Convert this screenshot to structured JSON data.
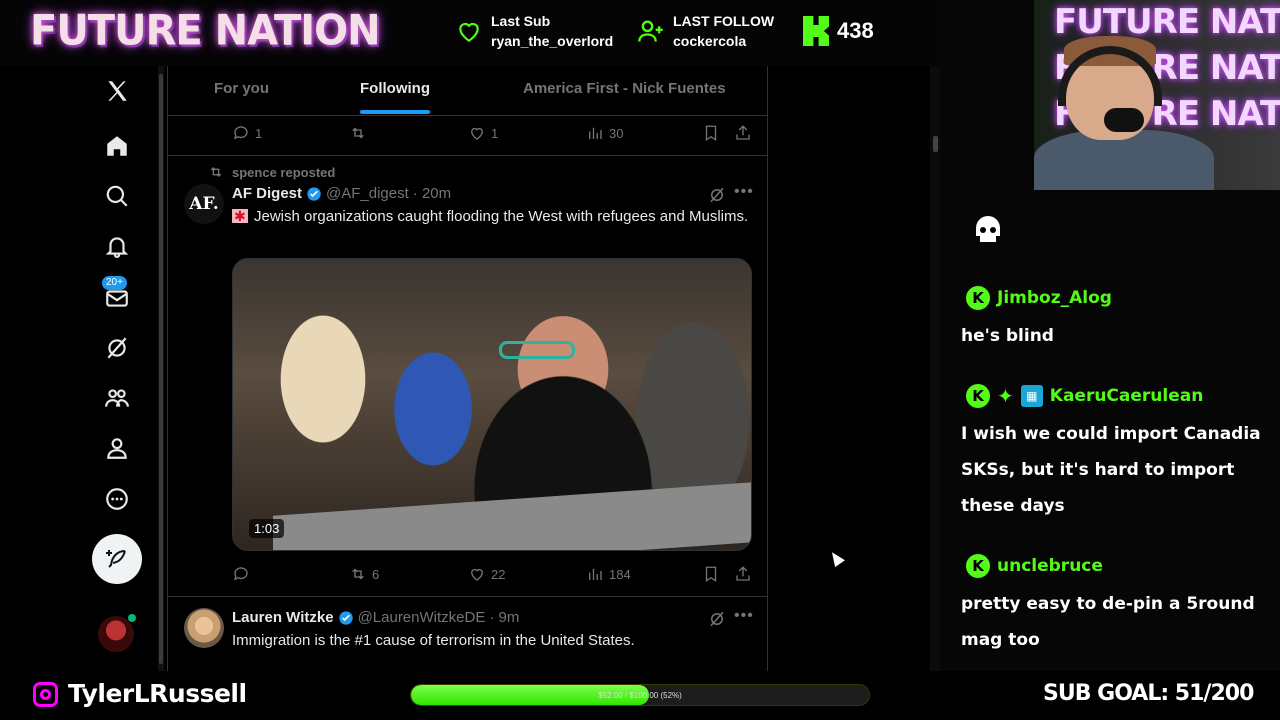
{
  "stream": {
    "brand": "FUTURE NATION",
    "last_sub_label": "Last Sub",
    "last_sub_user": "ryan_the_overlord",
    "last_follow_label": "LAST FOLLOW",
    "last_follow_user": "cockercola",
    "kick_count": "438",
    "accent": "#53fc18"
  },
  "twitter": {
    "tabs": [
      {
        "label": "For you"
      },
      {
        "label": "Following"
      },
      {
        "label": "America First - Nick Fuentes"
      }
    ],
    "active_tab": "Following",
    "nav_badge": "20+",
    "prev_post": {
      "replies": "1",
      "reposts": "",
      "likes": "1",
      "views": "30"
    },
    "post1": {
      "repost_by": "spence reposted",
      "avatar_text": "AF.",
      "name": "AF Digest",
      "handle": "@AF_digest",
      "time": "· 20m",
      "text": "Jewish organizations caught flooding the West with refugees and Muslims.",
      "video_duration": "1:03",
      "replies": "",
      "reposts": "6",
      "likes": "22",
      "views": "184"
    },
    "post2": {
      "name": "Lauren Witzke",
      "handle": "@LaurenWitzkeDE",
      "time": "· 9m",
      "text": "Immigration is the #1 cause of terrorism in the United States."
    }
  },
  "chat": {
    "messages": [
      {
        "user": "Jimboz_Alog",
        "text": "he's blind"
      },
      {
        "user": "KaeruCaerulean",
        "text": "I wish we could import Canadia SKSs, but it's hard to import these days"
      },
      {
        "user": "unclebruce",
        "text": "pretty easy to de-pin a 5round mag too"
      }
    ]
  },
  "footer": {
    "instagram_handle": "TylerLRussell",
    "progress_text": "$52.00 / $100.00 (52%)",
    "progress_fraction": 0.52,
    "sub_goal": "SUB GOAL: 51/200"
  }
}
